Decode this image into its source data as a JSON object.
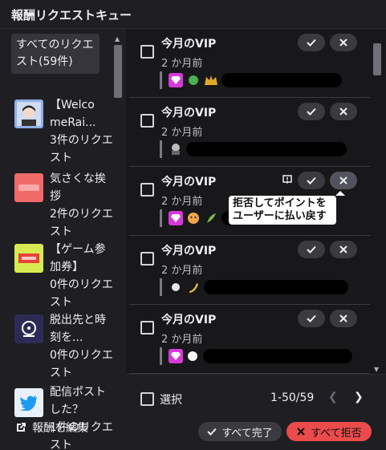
{
  "header": {
    "title": "報酬リクエストキュー"
  },
  "sidebar": {
    "all_label": "すべてのリクエスト(59件)",
    "items": [
      {
        "name": "【Welco meRai...",
        "count": "3件のリクエスト",
        "icon": "avatar-icon"
      },
      {
        "name": "気さくな挨拶",
        "count": "2件のリクエスト",
        "icon": "greeting-icon"
      },
      {
        "name": "【ゲーム参加券】",
        "count": "0件のリクエスト",
        "icon": "ticket-icon"
      },
      {
        "name": "脱出先と時刻を...",
        "count": "0件のリクエスト",
        "icon": "clock-icon"
      },
      {
        "name": "配信ポストした？",
        "count": "1件のリクエスト",
        "icon": "twitter-icon"
      }
    ],
    "edit_label": "報酬を編集"
  },
  "requests": [
    {
      "title": "今月のVIP",
      "time": "2 か月前"
    },
    {
      "title": "今月のVIP",
      "time": "2 か月前"
    },
    {
      "title": "今月のVIP",
      "time": "2 か月前"
    },
    {
      "title": "今月のVIP",
      "time": "2 か月前"
    },
    {
      "title": "今月のVIP",
      "time": "2 か月前"
    }
  ],
  "tooltip": {
    "text": "拒否してポイントをユーザーに払い戻す"
  },
  "footer": {
    "select_label": "選択",
    "page_info": "1-50/59",
    "complete_all": "すべて完了",
    "reject_all": "すべて拒否"
  },
  "colors": {
    "accent_reject": "#eb4b4b",
    "background": "#18181b"
  }
}
